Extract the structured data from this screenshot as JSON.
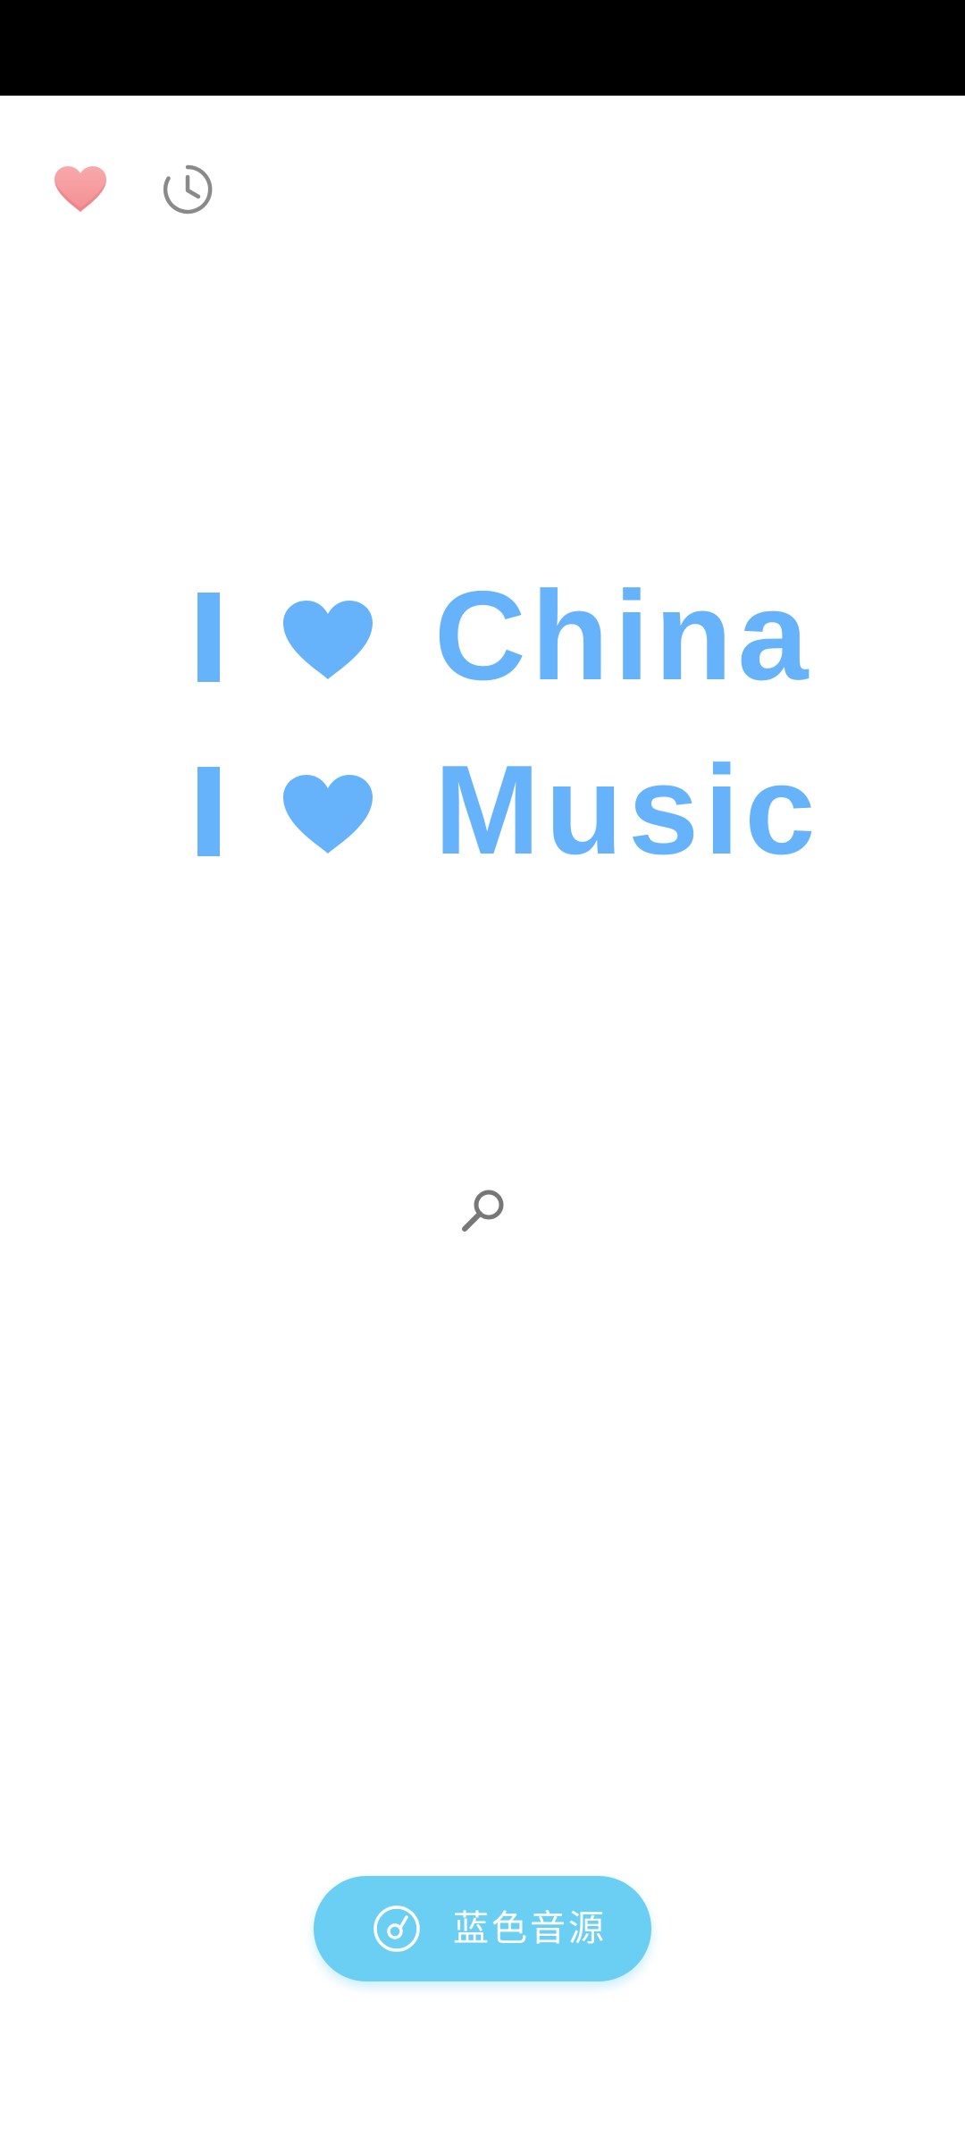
{
  "status_bar": {
    "color": "#000000"
  },
  "top_bar": {
    "favorites_icon": "heart-icon",
    "history_icon": "history-icon",
    "favorites_color": "#f7a0a4",
    "history_color": "#8a8a8a"
  },
  "slogan": {
    "color": "#66b3fb",
    "lines": [
      {
        "pronoun": "I",
        "symbol": "heart-icon",
        "word": "China"
      },
      {
        "pronoun": "I",
        "symbol": "heart-icon",
        "word": "Music"
      }
    ]
  },
  "search": {
    "icon": "search-icon",
    "color": "#777777"
  },
  "source_button": {
    "label": "蓝色音源",
    "icon": "disc-icon",
    "background": "#6acff3",
    "text_color": "#ffffff"
  }
}
